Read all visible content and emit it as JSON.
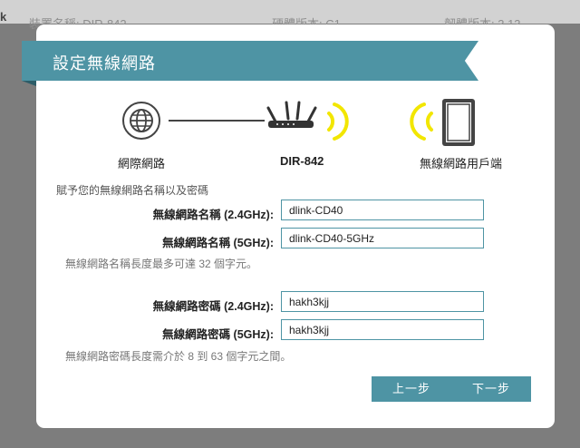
{
  "background": {
    "device_name": "裝置名稱: DIR-842",
    "hardware": "硬體版本: C1",
    "firmware": "韌體版本: 3.13"
  },
  "dialog": {
    "title": "設定無線網路",
    "diagram": {
      "internet_label": "網際網路",
      "router_label": "DIR-842",
      "client_label": "無線網路用戶端"
    },
    "intro": "賦予您的無線網路名稱以及密碼",
    "ssid_24_label": "無線網路名稱 (2.4GHz):",
    "ssid_24_value": "dlink-CD40",
    "ssid_5_label": "無線網路名稱 (5GHz):",
    "ssid_5_value": "dlink-CD40-5GHz",
    "ssid_hint": "無線網路名稱長度最多可達 32 個字元。",
    "pw_24_label": "無線網路密碼 (2.4GHz):",
    "pw_24_value": "hakh3kjj",
    "pw_5_label": "無線網路密碼 (5GHz):",
    "pw_5_value": "hakh3kjj",
    "pw_hint": "無線網路密碼長度需介於 8 到 63 個字元之間。",
    "back_label": "上一步",
    "next_label": "下一步"
  },
  "colors": {
    "accent": "#4e94a4",
    "wifi_wave": "#f2e600"
  }
}
